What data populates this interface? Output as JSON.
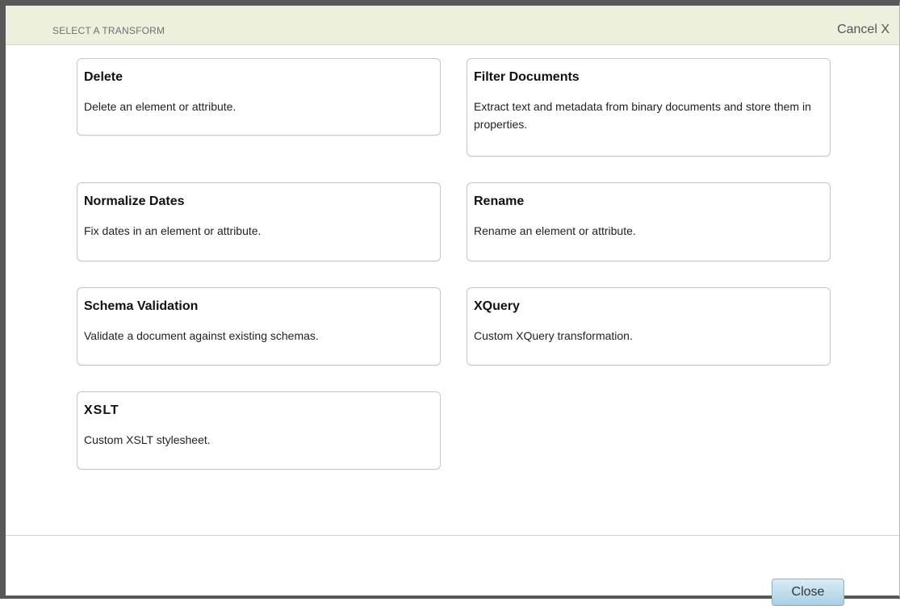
{
  "header": {
    "title": "SELECT A TRANSFORM",
    "cancel_label": "Cancel X"
  },
  "transforms": [
    {
      "name": "Delete",
      "description": "Delete an element or attribute."
    },
    {
      "name": "Filter Documents",
      "description": "Extract text and metadata from binary documents and store them in properties."
    },
    {
      "name": "Normalize Dates",
      "description": "Fix dates in an element or attribute."
    },
    {
      "name": "Rename",
      "description": "Rename an element or attribute."
    },
    {
      "name": "Schema Validation",
      "description": "Validate a document against existing schemas."
    },
    {
      "name": "XQuery",
      "description": "Custom XQuery transformation."
    },
    {
      "name": "XSLT",
      "description": "Custom XSLT stylesheet."
    }
  ],
  "footer": {
    "close_label": "Close"
  }
}
